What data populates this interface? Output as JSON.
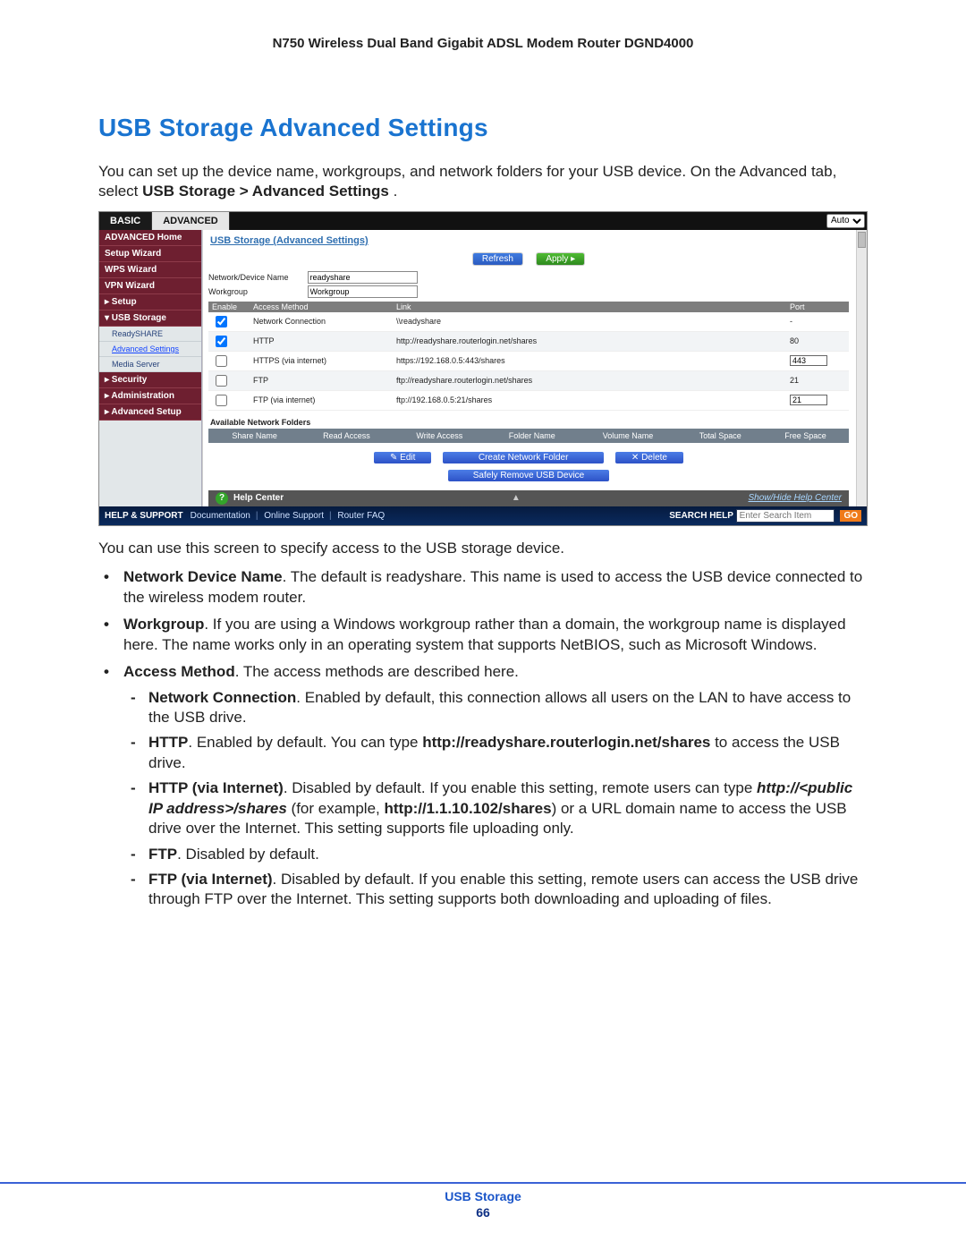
{
  "doc_title": "N750 Wireless Dual Band Gigabit ADSL Modem Router DGND4000",
  "section_heading": "USB Storage Advanced Settings",
  "intro_p1": "You can set up the device name, workgroups, and network folders for your USB device. On the Advanced tab, select ",
  "intro_crumb": "USB Storage > Advanced Settings",
  "intro_p1_tail": ".",
  "after_shot": "You can use this screen to specify access to the USB storage device.",
  "screenshot": {
    "tabs": {
      "basic": "BASIC",
      "advanced": "ADVANCED",
      "auto": "Auto"
    },
    "sidebar": {
      "items": [
        {
          "label": "ADVANCED Home"
        },
        {
          "label": "Setup Wizard"
        },
        {
          "label": "WPS Wizard"
        },
        {
          "label": "VPN Wizard"
        },
        {
          "label": "▸ Setup"
        },
        {
          "label": "▾ USB Storage",
          "subs": [
            {
              "label": "ReadySHARE"
            },
            {
              "label": "Advanced Settings",
              "selected": true
            },
            {
              "label": "Media Server"
            }
          ]
        },
        {
          "label": "▸ Security"
        },
        {
          "label": "▸ Administration"
        },
        {
          "label": "▸ Advanced Setup"
        }
      ]
    },
    "pane_title": "USB Storage (Advanced Settings)",
    "refresh": "Refresh",
    "apply": "Apply   ▸",
    "fields": {
      "device_label": "Network/Device Name",
      "device_value": "readyshare",
      "workgroup_label": "Workgroup",
      "workgroup_value": "Workgroup"
    },
    "cols": {
      "enable": "Enable",
      "method": "Access Method",
      "link": "Link",
      "port": "Port"
    },
    "rows": [
      {
        "checked": true,
        "method": "Network Connection",
        "link": "\\\\readyshare",
        "port": "-"
      },
      {
        "checked": true,
        "method": "HTTP",
        "link": "http://readyshare.routerlogin.net/shares",
        "port": "80"
      },
      {
        "checked": false,
        "method": "HTTPS (via internet)",
        "link": "https://192.168.0.5:443/shares",
        "port_input": "443"
      },
      {
        "checked": false,
        "method": "FTP",
        "link": "ftp://readyshare.routerlogin.net/shares",
        "port": "21"
      },
      {
        "checked": false,
        "method": "FTP (via internet)",
        "link": "ftp://192.168.0.5:21/shares",
        "port_input": "21"
      }
    ],
    "folders_header": "Available Network Folders",
    "folders_cols": [
      "Share Name",
      "Read Access",
      "Write Access",
      "Folder Name",
      "Volume Name",
      "Total Space",
      "Free Space"
    ],
    "btn_edit": "Edit",
    "btn_create": "Create Network Folder",
    "btn_delete": "Delete",
    "btn_safely": "Safely Remove USB Device",
    "help_center": "Help Center",
    "help_toggle": "Show/Hide Help Center",
    "help_strip": {
      "label": "HELP & SUPPORT",
      "links": [
        "Documentation",
        "Online Support",
        "Router FAQ"
      ],
      "search_label": "SEARCH HELP",
      "placeholder": "Enter Search Item",
      "go": "GO"
    }
  },
  "bullets": [
    {
      "term": "Network Device Name",
      "text": ". The default is readyshare. This name is used to access the USB device connected to the wireless modem router."
    },
    {
      "term": "Workgroup",
      "text": ". If you are using a Windows workgroup rather than a domain, the workgroup name is displayed here. The name works only in an operating system that supports NetBIOS, such as Microsoft Windows."
    },
    {
      "term": "Access Method",
      "text": ". The access methods are described here.",
      "subs": [
        {
          "term": "Network Connection",
          "text": ". Enabled by default, this connection allows all users on the LAN to have access to the USB drive."
        },
        {
          "term": "HTTP",
          "pre": ". Enabled by default. You can type ",
          "bold": "http://readyshare.routerlogin.net/shares",
          "post": " to access the USB drive."
        },
        {
          "term": "HTTP (via Internet)",
          "pre": ". Disabled by default. If you enable this setting, remote users can type ",
          "bolditalic1": "http://<public IP address>/shares",
          "mid": " (for example, ",
          "bold2": "http://1.1.10.102/shares",
          "post": ") or a URL domain name to access the USB drive over the Internet. This setting supports file uploading only."
        },
        {
          "term": "FTP",
          "text": ". Disabled by default."
        },
        {
          "term": "FTP (via Internet)",
          "text": ". Disabled by default. If you enable this setting, remote users can access the USB drive through FTP over the Internet. This setting supports both downloading and uploading of files."
        }
      ]
    }
  ],
  "footer": {
    "title": "USB Storage",
    "page": "66"
  }
}
